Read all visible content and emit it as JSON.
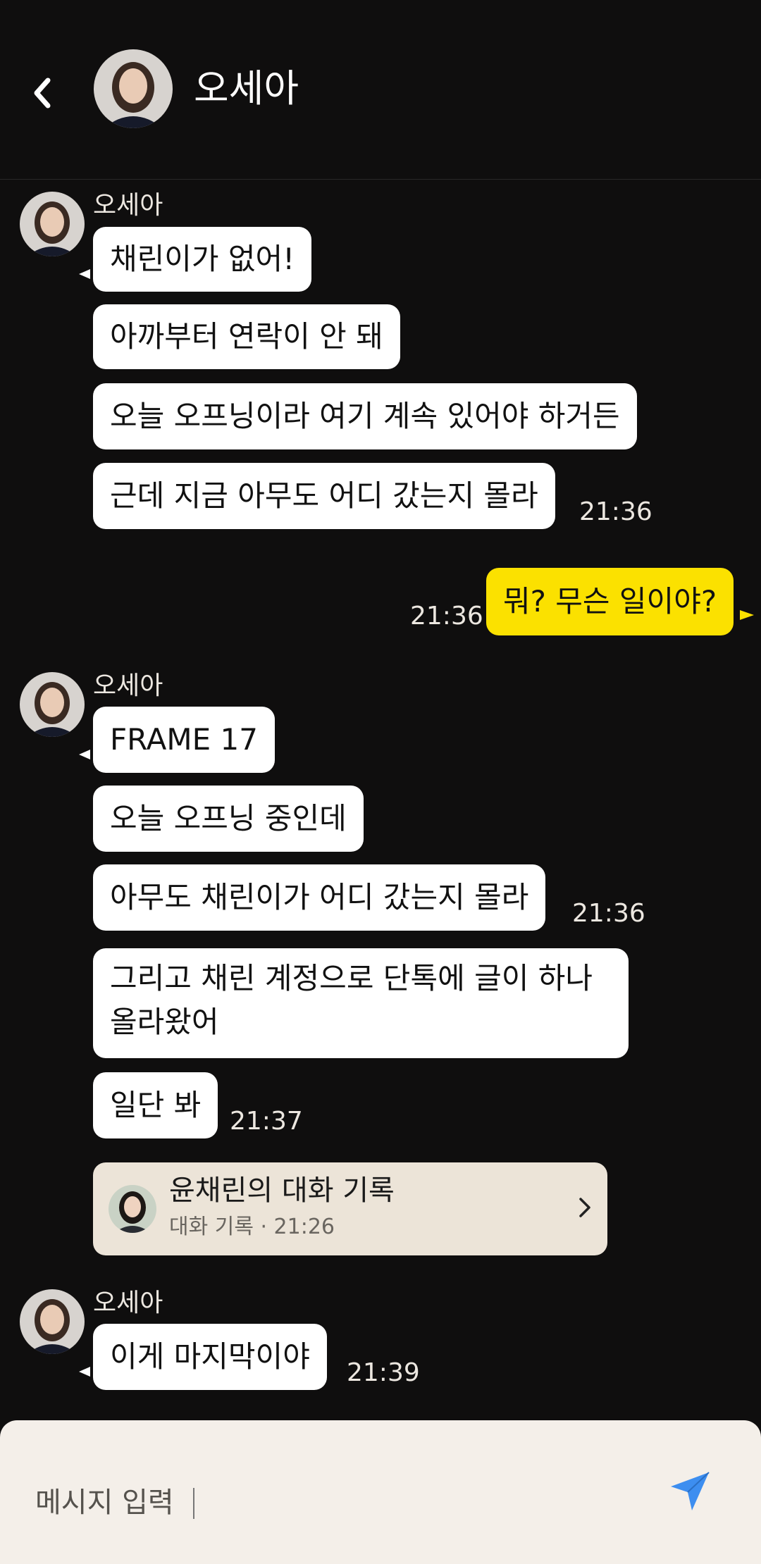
{
  "header": {
    "title": "오세아"
  },
  "groups": [
    {
      "sender": "오세아",
      "messages": [
        {
          "text": "채린이가 없어!",
          "time": ""
        },
        {
          "text": "아까부터 연락이 안 돼",
          "time": ""
        },
        {
          "text": "오늘 오프닝이라 여기 계속 있어야 하거든",
          "time": ""
        },
        {
          "text": "근데 지금 아무도 어디 갔는지 몰라",
          "time": "21:36"
        }
      ]
    },
    {
      "sender": "me",
      "messages": [
        {
          "text": "뭐? 무슨 일이야?",
          "time": "21:36"
        }
      ]
    },
    {
      "sender": "오세아",
      "messages": [
        {
          "text": "FRAME 17",
          "time": ""
        },
        {
          "text": "오늘 오프닝 중인데",
          "time": ""
        },
        {
          "text": "아무도 채린이가 어디 갔는지 몰라",
          "time": "21:36"
        },
        {
          "text": "그리고 채린 계정으로 단톡에 글이 하나 올라왔어",
          "time": ""
        },
        {
          "text": "일단 봐",
          "time": "21:37"
        }
      ],
      "card": {
        "title": "윤채린의 대화 기록",
        "meta": "대화 기록 · 21:26"
      }
    },
    {
      "sender": "오세아",
      "messages": [
        {
          "text": "이게 마지막이야",
          "time": "21:39"
        }
      ]
    }
  ],
  "input": {
    "placeholder": "메시지 입력"
  },
  "colors": {
    "background": "#0f0e0e",
    "my_bubble": "#fbe100",
    "their_bubble": "#ffffff",
    "card": "#ece4d8",
    "send": "#3d8ef0"
  },
  "icons": [
    "back-icon",
    "avatar",
    "chevron-right-icon",
    "send-icon"
  ]
}
